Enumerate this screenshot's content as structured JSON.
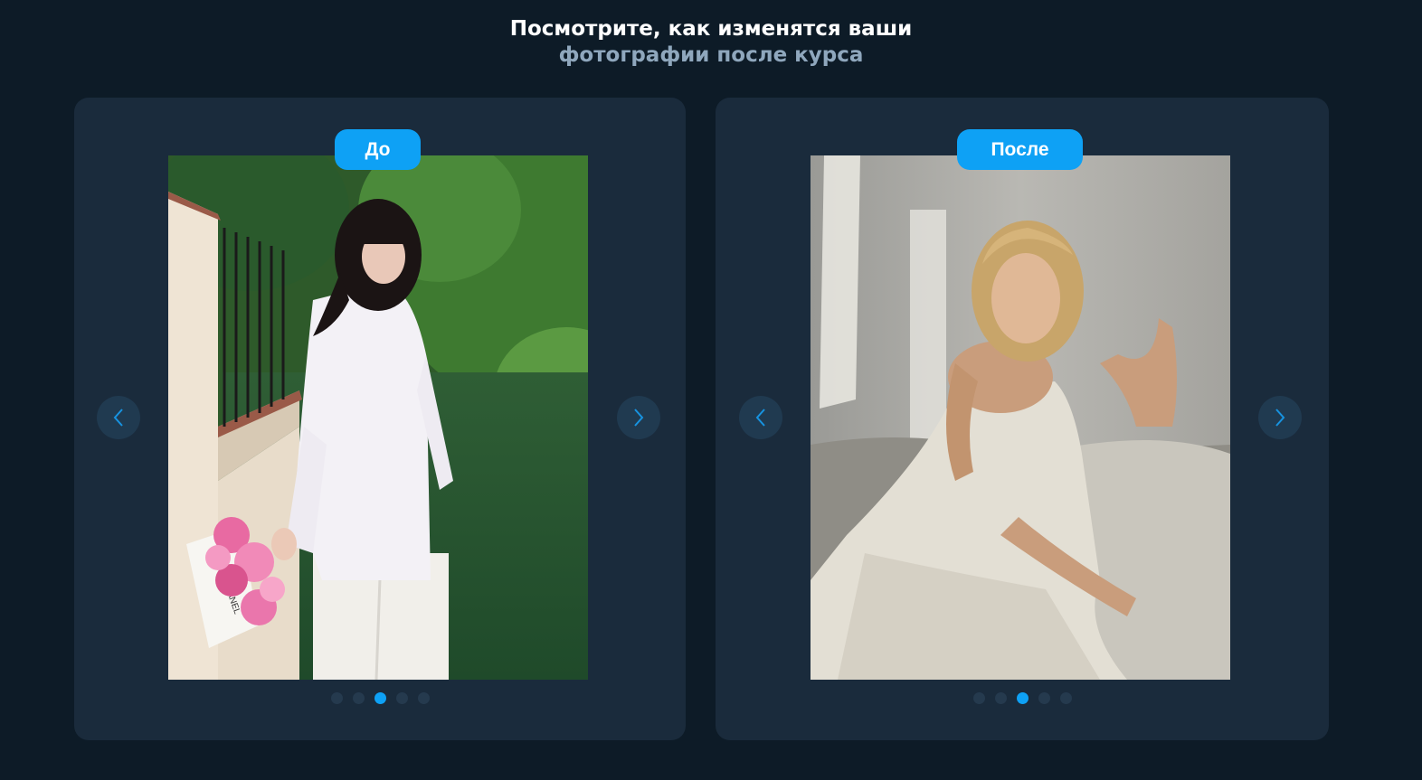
{
  "heading": {
    "line1": "Посмотрите, как изменятся ваши",
    "line2": "фотографии после курса"
  },
  "colors": {
    "background": "#0d1b27",
    "card": "#1a2b3c",
    "accent": "#0ea1f5",
    "heading_secondary": "#8fa7bd"
  },
  "before_card": {
    "badge": "До",
    "prev_icon": "chevron-left-icon",
    "next_icon": "chevron-right-icon",
    "dots_total": 5,
    "dots_active": 3
  },
  "after_card": {
    "badge": "После",
    "prev_icon": "chevron-left-icon",
    "next_icon": "chevron-right-icon",
    "dots_total": 5,
    "dots_active": 3
  }
}
